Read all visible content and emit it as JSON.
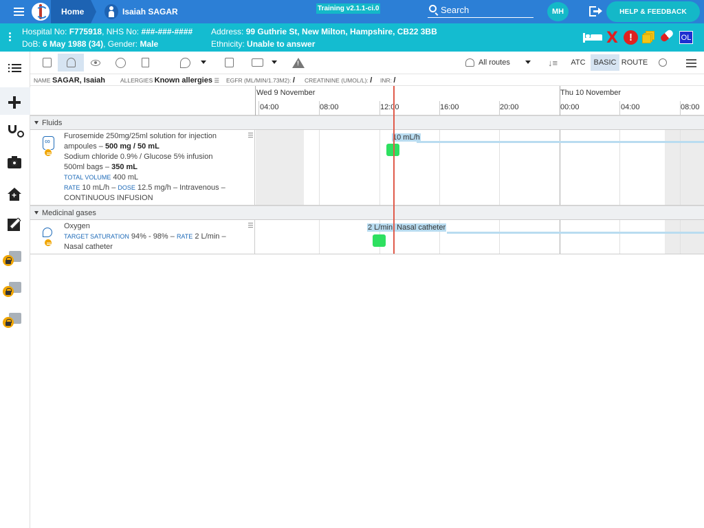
{
  "topbar": {
    "home_label": "Home",
    "patient_name": "Isaiah SAGAR",
    "version": "Training v2.1.1-ci.0",
    "search_label": "Search",
    "user_initials": "MH",
    "help_label": "HELP & FEEDBACK"
  },
  "banner": {
    "hospital_no_label": "Hospital No:",
    "hospital_no": "F775918",
    "nhs_no_label": "NHS No:",
    "nhs_no": "###-###-####",
    "dob_label": "DoB:",
    "dob": "6 May 1988 (34)",
    "gender_label": "Gender:",
    "gender": "Male",
    "address_label": "Address:",
    "address": "99 Guthrie St, New Milton, Hampshire, CB22 3BB",
    "ethnicity_label": "Ethnicity:",
    "ethnicity": "Unable to answer",
    "badge_ol": "OL",
    "badge_x": "X",
    "badge_warn": "!"
  },
  "toolbar": {
    "routes_label": "All routes",
    "view_atc": "ATC",
    "view_basic": "BASIC",
    "view_route": "ROUTE",
    "sort_glyph": "↓≡"
  },
  "inforow": {
    "name_label": "NAME",
    "name": "SAGAR, Isaiah",
    "allergies_label": "ALLERGIES",
    "allergies": "Known allergies",
    "allergies_menu": "☰",
    "egfr_label": "EGFR (ML/MIN/1.73M2):",
    "egfr": "/",
    "creatinine_label": "CREATININE (UMOL/L):",
    "creatinine": "/",
    "inr_label": "INR:",
    "inr": "/"
  },
  "timeline": {
    "days": [
      "Wed 9 November",
      "Thu 10 November"
    ],
    "hours": [
      "04:00",
      "08:00",
      "12:00",
      "16:00",
      "20:00",
      "00:00",
      "04:00",
      "08:00"
    ]
  },
  "groups": {
    "fluids": "Fluids",
    "gases": "Medicinal gases"
  },
  "fluid_row": {
    "line1": "Furosemide 250mg/25ml solution for injection",
    "line2a": "ampoules – ",
    "line2b": "500 mg / 50 mL",
    "line3": "Sodium chloride 0.9% / Glucose 5% infusion",
    "line4a": "500ml bags – ",
    "line4b": "350 mL",
    "total_label": "TOTAL VOLUME",
    "total_value": " 400 mL",
    "rate_label": "RATE",
    "rate_value": " 10 mL/h – ",
    "dose_label": "DOSE",
    "dose_value": " 12.5 mg/h – Intravenous –",
    "line7": "CONTINUOUS INFUSION",
    "bar_label": "10 mL/h"
  },
  "gas_row": {
    "line1": "Oxygen",
    "target_label": "TARGET SATURATION",
    "target_value": " 94% - 98% – ",
    "rate_label": "RATE",
    "rate_value": " 2 L/min –",
    "line3": "Nasal catheter",
    "bar_label": "2 L/min, Nasal catheter"
  }
}
